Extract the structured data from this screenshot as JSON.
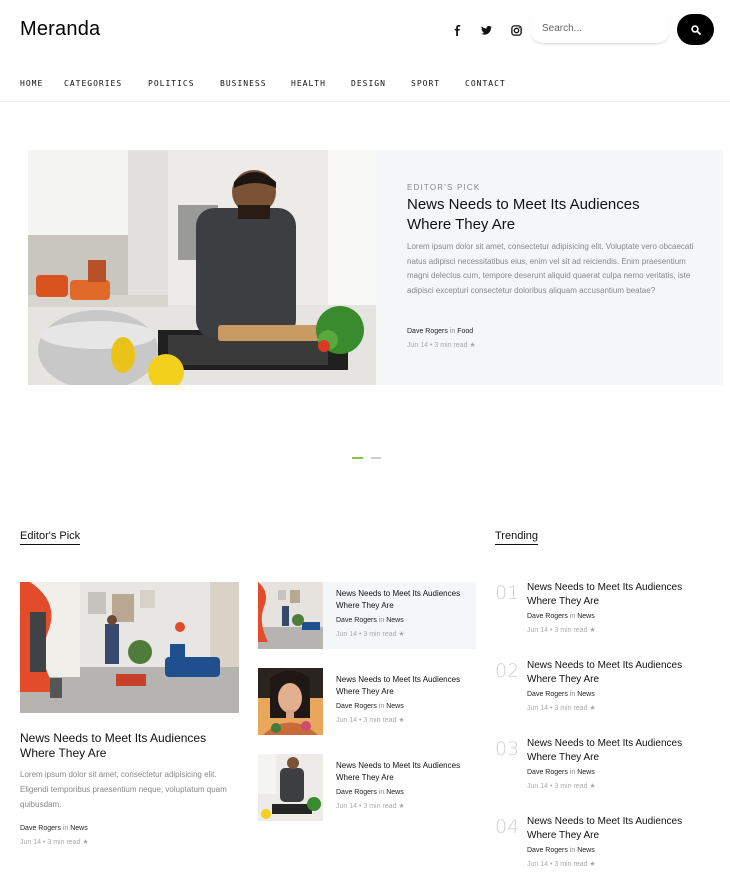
{
  "header": {
    "logo": "Meranda",
    "social_icons": [
      "facebook-icon",
      "twitter-icon",
      "instagram-icon"
    ],
    "search_placeholder": "Search...",
    "search_icon": "search-icon"
  },
  "nav": {
    "items": [
      "HOME",
      "CATEGORIES",
      "POLITICS",
      "BUSINESS",
      "HEALTH",
      "DESIGN",
      "SPORT",
      "CONTACT"
    ]
  },
  "hero": {
    "kicker": "EDITOR'S PICK",
    "title": "News Needs to Meet Its Audiences Where They Are",
    "body": "Lorem ipsum dolor sit amet, consectetur adipisicing elit. Voluptate vero obcaecati natus adipisci necessitatibus eius, enim vel sit ad reiciendis. Enim praesentium magni delectus cum, tempore deserunt aliquid quaerat culpa nemo veritatis, iste adipisci excepturi consectetur doloribus aliquam accusantium beatae?",
    "author": "Dave Rogers",
    "in_label": "in",
    "category": "Food",
    "date": "Jun 14",
    "read_time": "3 min read",
    "carousel_active_index": 0,
    "carousel_count": 2,
    "accent_color": "#8bc34a"
  },
  "editors_pick": {
    "heading": "Editor's Pick",
    "main": {
      "title": "News Needs to Meet Its Audiences Where They Are",
      "body": "Lorem ipsum dolor sit amet, consectetur adipisicing elit. Eligendi temporibus praesentium neque, voluptatum quam quibusdam.",
      "author": "Dave Rogers",
      "in_label": "in",
      "category": "News",
      "date": "Jun 14",
      "read_time": "3 min read"
    },
    "items": [
      {
        "title": "News Needs to Meet Its Audiences Where They Are",
        "author": "Dave Rogers",
        "in_label": "in",
        "category": "News",
        "date": "Jun 14",
        "read_time": "3 min read"
      },
      {
        "title": "News Needs to Meet Its Audiences Where They Are",
        "author": "Dave Rogers",
        "in_label": "in",
        "category": "News",
        "date": "Jun 14",
        "read_time": "3 min read"
      },
      {
        "title": "News Needs to Meet Its Audiences Where They Are",
        "author": "Dave Rogers",
        "in_label": "in",
        "category": "News",
        "date": "Jun 14",
        "read_time": "3 min read"
      }
    ]
  },
  "trending": {
    "heading": "Trending",
    "items": [
      {
        "num": "01",
        "title": "News Needs to Meet Its Audiences Where They Are",
        "author": "Dave Rogers",
        "in_label": "in",
        "category": "News",
        "date": "Jun 14",
        "read_time": "3 min read"
      },
      {
        "num": "02",
        "title": "News Needs to Meet Its Audiences Where They Are",
        "author": "Dave Rogers",
        "in_label": "in",
        "category": "News",
        "date": "Jun 14",
        "read_time": "3 min read"
      },
      {
        "num": "03",
        "title": "News Needs to Meet Its Audiences Where They Are",
        "author": "Dave Rogers",
        "in_label": "in",
        "category": "News",
        "date": "Jun 14",
        "read_time": "3 min read"
      },
      {
        "num": "04",
        "title": "News Needs to Meet Its Audiences Where They Are",
        "author": "Dave Rogers",
        "in_label": "in",
        "category": "News",
        "date": "Jun 14",
        "read_time": "3 min read"
      }
    ]
  },
  "meta": {
    "separator": "•",
    "star_icon": "star-icon"
  }
}
